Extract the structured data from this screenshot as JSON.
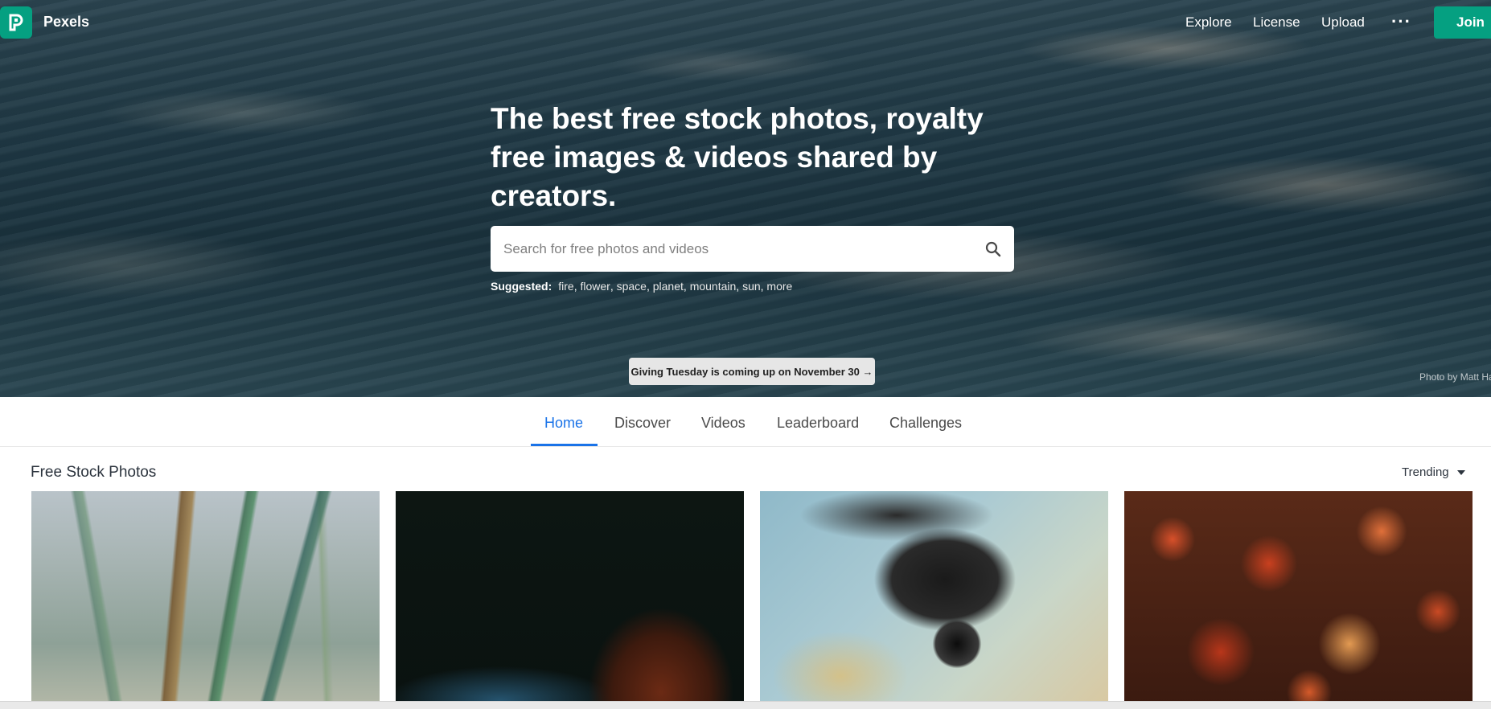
{
  "brand": {
    "name": "Pexels",
    "color": "#05a081"
  },
  "nav": {
    "links": [
      {
        "label": "Explore"
      },
      {
        "label": "License"
      },
      {
        "label": "Upload"
      }
    ],
    "more_label": "···",
    "join_label": "Join"
  },
  "hero": {
    "title": "The best free stock photos, royalty free images & videos shared by creators.",
    "search": {
      "placeholder": "Search for free photos and videos",
      "value": ""
    },
    "suggested_label": "Suggested:",
    "suggested": [
      "fire",
      "flower",
      "space",
      "planet",
      "mountain",
      "sun",
      "more"
    ],
    "banner": "Giving Tuesday is coming up on November 30 →",
    "credit": "Photo by Matt Ha"
  },
  "tabs": {
    "items": [
      {
        "label": "Home",
        "active": true
      },
      {
        "label": "Discover"
      },
      {
        "label": "Videos"
      },
      {
        "label": "Leaderboard"
      },
      {
        "label": "Challenges"
      }
    ],
    "active_color": "#1a73e8"
  },
  "section": {
    "title": "Free Stock Photos",
    "sort": "Trending"
  },
  "photos": [
    {
      "subject": "grass reeds"
    },
    {
      "subject": "dark water with red hair"
    },
    {
      "subject": "camera on map"
    },
    {
      "subject": "red autumn leaves"
    }
  ]
}
